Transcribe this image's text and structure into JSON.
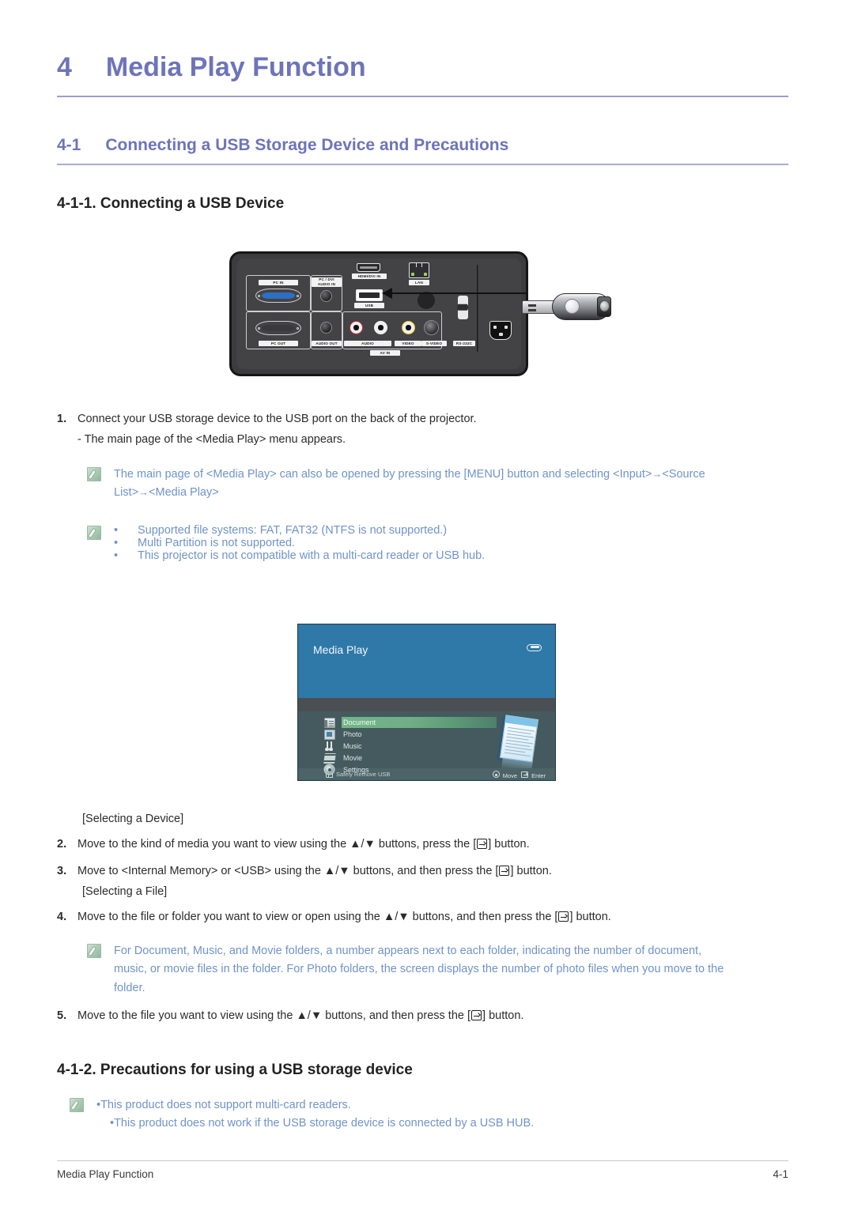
{
  "chapter": {
    "number": "4",
    "title": "Media Play Function"
  },
  "section": {
    "number": "4-1",
    "title": "Connecting a USB Storage Device and Precautions"
  },
  "subsections": {
    "one": "4-1-1. Connecting a USB Device",
    "two": "4-1-2. Precautions for using a USB storage device"
  },
  "steps": {
    "s1_num": "1.",
    "s1_text": "Connect your USB storage device to the USB port on the back of the projector.",
    "s1_sub": "- The main page of the <Media Play> menu appears.",
    "note1_line1": "The main page of <Media Play> can also be opened by pressing the [MENU] button and selecting  <Input>",
    "note1_arrow1": "→",
    "note1_mid": "<Source",
    "note1_line2a": "List>",
    "note1_arrow2": "→",
    "note1_line2b": "<Media Play>",
    "note2_bullets": [
      "Supported file systems: FAT, FAT32 (NTFS is not supported.)",
      "Multi Partition is not supported.",
      "This projector is not compatible with a multi-card reader or USB hub."
    ],
    "bracket_device": "[Selecting a Device]",
    "bracket_file": "[Selecting a File]",
    "s2_num": "2.",
    "s2_a": "Move to the kind of media you want to view using the ▲/▼ buttons, press the [",
    "s2_b": "] button.",
    "s3_num": "3.",
    "s3_a": "Move to <Internal Memory> or <USB> using the ▲/▼ buttons, and then press the [",
    "s3_b": "] button.",
    "s4_num": "4.",
    "s4_a": "Move to the file or folder you want to view or open using the ▲/▼ buttons, and then press the [",
    "s4_b": "] button.",
    "note3_line1": "For Document, Music, and Movie folders, a number appears next to each folder, indicating the number of document,",
    "note3_line2": "music, or movie files in the folder. For Photo folders, the screen displays the number of photo files when you move to the",
    "note3_line3": "folder.",
    "s5_num": "5.",
    "s5_a": "Move to the file you want to view using the ▲/▼ buttons, and then press the [",
    "s5_b": "] button."
  },
  "precautions": {
    "bullets": [
      "•This product does not support multi-card readers.",
      "•This product does not work if the USB storage device is connected by a USB HUB."
    ]
  },
  "osd": {
    "title": "Media Play",
    "items": [
      {
        "label": "Document",
        "icon": "document-icon",
        "selected": true
      },
      {
        "label": "Photo",
        "icon": "photo-icon",
        "selected": false
      },
      {
        "label": "Music",
        "icon": "music-icon",
        "selected": false
      },
      {
        "label": "Movie",
        "icon": "movie-icon",
        "selected": false
      },
      {
        "label": "Settings",
        "icon": "settings-gear-icon",
        "selected": false
      }
    ],
    "footer_left": "Safely Remove USB",
    "footer_move": "Move",
    "footer_enter": "Enter"
  },
  "projector": {
    "labels": {
      "pc_in": "PC IN",
      "pc_dvi_audio_in": "PC / DVI\nAUDIO IN",
      "pc_out": "PC OUT",
      "audio_out": "AUDIO OUT",
      "audio": "AUDIO",
      "video": "VIDEO",
      "svideo": "S-VIDEO",
      "av_in": "AV IN",
      "hdmi": "HDMI/DVI IN",
      "lan": "LAN",
      "usb": "USB",
      "rs232c": "RS-232C"
    }
  },
  "footer": {
    "left": "Media Play Function",
    "right": "4-1"
  },
  "colors": {
    "heading": "#6d74b8",
    "note_text": "#6f93c9",
    "note_icon": "#a9c9b2",
    "osd_header": "#2f79a8",
    "osd_body": "#445a5e",
    "osd_highlight": "#6fae86"
  }
}
